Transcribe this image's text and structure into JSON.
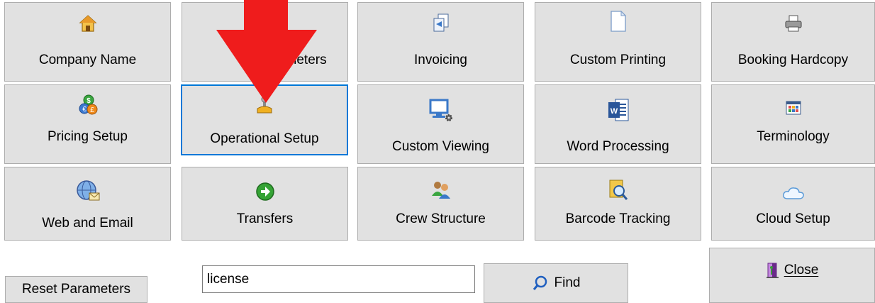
{
  "tiles": {
    "company_name": {
      "label": "Company Name",
      "icon": "house-icon"
    },
    "hidden_tile": {
      "label": "Parameters",
      "icon": "hidden-icon"
    },
    "invoicing": {
      "label": "Invoicing",
      "icon": "documents-icon"
    },
    "custom_printing": {
      "label": "Custom Printing",
      "icon": "blank-page-icon"
    },
    "booking_hardcopy": {
      "label": "Booking Hardcopy",
      "icon": "printer-icon"
    },
    "pricing_setup": {
      "label": "Pricing Setup",
      "icon": "currency-icon"
    },
    "operational_setup": {
      "label": "Operational Setup",
      "icon": "joystick-icon"
    },
    "custom_viewing": {
      "label": "Custom Viewing",
      "icon": "monitor-gear-icon"
    },
    "word_processing": {
      "label": "Word Processing",
      "icon": "word-icon"
    },
    "terminology": {
      "label": "Terminology",
      "icon": "grid-icon"
    },
    "web_and_email": {
      "label": "Web and Email",
      "icon": "globe-mail-icon"
    },
    "transfers": {
      "label": "Transfers",
      "icon": "green-arrow-icon"
    },
    "crew_structure": {
      "label": "Crew Structure",
      "icon": "people-icon"
    },
    "barcode_tracking": {
      "label": "Barcode Tracking",
      "icon": "magnifier-doc-icon"
    },
    "cloud_setup": {
      "label": "Cloud Setup",
      "icon": "cloud-icon"
    }
  },
  "bottom": {
    "reset_label": "Reset Parameters",
    "search_value": "license",
    "find_label": "Find",
    "close_label": "Close"
  },
  "colors": {
    "arrow": "#ef1c1c",
    "focus": "#0078d7",
    "tile_bg": "#e1e1e1"
  }
}
